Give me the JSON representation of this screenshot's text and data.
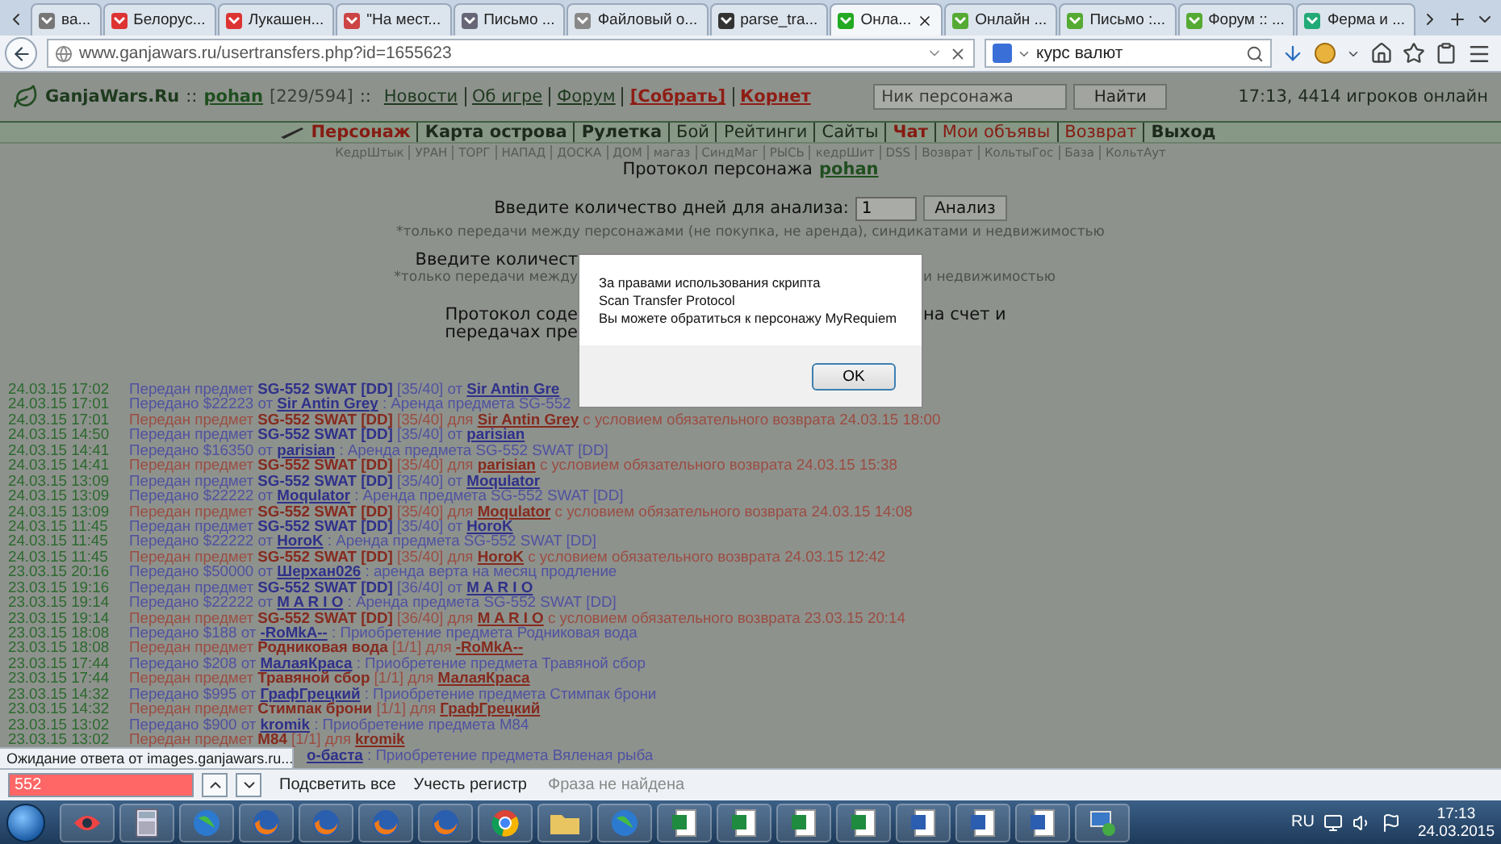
{
  "browser": {
    "tabs": [
      {
        "label": "ва...",
        "selected": false
      },
      {
        "label": "Белорус...",
        "selected": false
      },
      {
        "label": "Лукашен...",
        "selected": false
      },
      {
        "label": "\"На мест...",
        "selected": false
      },
      {
        "label": "Письмо ...",
        "selected": false
      },
      {
        "label": "Файловый о...",
        "selected": false
      },
      {
        "label": "parse_tra...",
        "selected": false
      },
      {
        "label": "Онла...",
        "selected": true
      },
      {
        "label": "Онлайн ...",
        "selected": false
      },
      {
        "label": "Письмо :...",
        "selected": false
      },
      {
        "label": "Форум :: ...",
        "selected": false
      },
      {
        "label": "Ферма и ...",
        "selected": false
      }
    ],
    "url": "www.ganjawars.ru/usertransfers.php?id=1655623",
    "search": "курс валют"
  },
  "header": {
    "brand": "GanjaWars.Ru",
    "separators": [
      "::",
      "::"
    ],
    "user": "pohan",
    "stats": "[229/594]",
    "links": [
      {
        "label": "Новости",
        "kind": "link"
      },
      {
        "label": "Об игре",
        "kind": "link"
      },
      {
        "label": "Форум",
        "kind": "link"
      },
      {
        "label": "[Собрать]",
        "kind": "action"
      },
      {
        "label": "Корнет",
        "kind": "action"
      }
    ],
    "search": {
      "placeholder": "Ник персонажа",
      "button": "Найти"
    },
    "online": "17:13, 4414 игроков онлайн"
  },
  "menu": [
    {
      "label": "Персонаж",
      "kind": "red-bold"
    },
    {
      "label": "Карта острова",
      "kind": "bold"
    },
    {
      "label": "Рулетка",
      "kind": "bold"
    },
    {
      "label": "Бой",
      "kind": "plain"
    },
    {
      "label": "Рейтинги",
      "kind": "plain"
    },
    {
      "label": "Сайты",
      "kind": "plain"
    },
    {
      "label": "Чат",
      "kind": "red-bold"
    },
    {
      "label": "Мои объявы",
      "kind": "red"
    },
    {
      "label": "Возврат",
      "kind": "red"
    },
    {
      "label": "Выход",
      "kind": "bold"
    }
  ],
  "sublinks": [
    "КедрШтык",
    "УРАН",
    "ТОРГ",
    "НАПАД",
    "ДОСКА",
    "ДОМ",
    "магаз",
    "СиндМаг",
    "РЫСЬ",
    "кедрШит",
    "DSS",
    "Возврат",
    "КольтыГос",
    "База",
    "КольтАут"
  ],
  "title": {
    "text": "Протокол персонажа",
    "user": "pohan"
  },
  "form": {
    "label": "Введите количество дней для анализа:",
    "value": "1",
    "button": "Анализ",
    "note": "*только передачи между персонажами (не покупка, не аренда), синдикатами и недвижимостью"
  },
  "covered_lines": [
    {
      "kind": "label",
      "left": "Введите количест"
    },
    {
      "kind": "note",
      "left": "*только передачи между",
      "right": "и недвижимостью"
    },
    {
      "kind": "text",
      "left": "Протокол соде",
      "right": "на счет и"
    },
    {
      "kind": "text",
      "left": "передачах пре"
    }
  ],
  "log": [
    {
      "date": "24.03.15 17:02",
      "outgoing": false,
      "parts": [
        {
          "kind": "text",
          "text": "Передан предмет"
        },
        {
          "kind": "bold",
          "text": "SG-552 SWAT [DD]"
        },
        {
          "kind": "text",
          "text": "[35/40] от"
        },
        {
          "kind": "link",
          "text": "Sir Antin Gre"
        }
      ]
    },
    {
      "date": "24.03.15 17:01",
      "outgoing": false,
      "parts": [
        {
          "kind": "text",
          "text": "Передано $22223 от"
        },
        {
          "kind": "link",
          "text": "Sir Antin Grey"
        },
        {
          "kind": "text",
          "text": ": Аренда предмета SG-552"
        }
      ]
    },
    {
      "date": "24.03.15 17:01",
      "outgoing": true,
      "parts": [
        {
          "kind": "text",
          "text": "Передан предмет"
        },
        {
          "kind": "bold",
          "text": "SG-552 SWAT [DD]"
        },
        {
          "kind": "text",
          "text": "[35/40] для"
        },
        {
          "kind": "link",
          "text": "Sir Antin Grey"
        },
        {
          "kind": "text",
          "text": "с условием обязательного возврата 24.03.15 18:00"
        }
      ]
    },
    {
      "date": "24.03.15 14:50",
      "outgoing": false,
      "parts": [
        {
          "kind": "text",
          "text": "Передан предмет"
        },
        {
          "kind": "bold",
          "text": "SG-552 SWAT [DD]"
        },
        {
          "kind": "text",
          "text": "[35/40] от"
        },
        {
          "kind": "link",
          "text": "parisian"
        }
      ]
    },
    {
      "date": "24.03.15 14:41",
      "outgoing": false,
      "parts": [
        {
          "kind": "text",
          "text": "Передано $16350 от"
        },
        {
          "kind": "link",
          "text": "parisian"
        },
        {
          "kind": "text",
          "text": ": Аренда предмета SG-552 SWAT [DD]"
        }
      ]
    },
    {
      "date": "24.03.15 14:41",
      "outgoing": true,
      "parts": [
        {
          "kind": "text",
          "text": "Передан предмет"
        },
        {
          "kind": "bold",
          "text": "SG-552 SWAT [DD]"
        },
        {
          "kind": "text",
          "text": "[35/40] для"
        },
        {
          "kind": "link",
          "text": "parisian"
        },
        {
          "kind": "text",
          "text": "с условием обязательного возврата 24.03.15 15:38"
        }
      ]
    },
    {
      "date": "24.03.15 13:09",
      "outgoing": false,
      "parts": [
        {
          "kind": "text",
          "text": "Передан предмет"
        },
        {
          "kind": "bold",
          "text": "SG-552 SWAT [DD]"
        },
        {
          "kind": "text",
          "text": "[35/40] от"
        },
        {
          "kind": "link",
          "text": "Moqulator"
        }
      ]
    },
    {
      "date": "24.03.15 13:09",
      "outgoing": false,
      "parts": [
        {
          "kind": "text",
          "text": "Передано $22222 от"
        },
        {
          "kind": "link",
          "text": "Moqulator"
        },
        {
          "kind": "text",
          "text": ": Аренда предмета SG-552 SWAT [DD]"
        }
      ]
    },
    {
      "date": "24.03.15 13:09",
      "outgoing": true,
      "parts": [
        {
          "kind": "text",
          "text": "Передан предмет"
        },
        {
          "kind": "bold",
          "text": "SG-552 SWAT [DD]"
        },
        {
          "kind": "text",
          "text": "[35/40] для"
        },
        {
          "kind": "link",
          "text": "Moqulator"
        },
        {
          "kind": "text",
          "text": "с условием обязательного возврата 24.03.15 14:08"
        }
      ]
    },
    {
      "date": "24.03.15 11:45",
      "outgoing": false,
      "parts": [
        {
          "kind": "text",
          "text": "Передан предмет"
        },
        {
          "kind": "bold",
          "text": "SG-552 SWAT [DD]"
        },
        {
          "kind": "text",
          "text": "[35/40] от"
        },
        {
          "kind": "link",
          "text": "HoroK"
        }
      ]
    },
    {
      "date": "24.03.15 11:45",
      "outgoing": false,
      "parts": [
        {
          "kind": "text",
          "text": "Передано $22222 от"
        },
        {
          "kind": "link",
          "text": "HoroK"
        },
        {
          "kind": "text",
          "text": ": Аренда предмета SG-552 SWAT [DD]"
        }
      ]
    },
    {
      "date": "24.03.15 11:45",
      "outgoing": true,
      "parts": [
        {
          "kind": "text",
          "text": "Передан предмет"
        },
        {
          "kind": "bold",
          "text": "SG-552 SWAT [DD]"
        },
        {
          "kind": "text",
          "text": "[35/40] для"
        },
        {
          "kind": "link",
          "text": "HoroK"
        },
        {
          "kind": "text",
          "text": "с условием обязательного возврата 24.03.15 12:42"
        }
      ]
    },
    {
      "date": "23.03.15 20:16",
      "outgoing": false,
      "parts": [
        {
          "kind": "text",
          "text": "Передано $50000 от"
        },
        {
          "kind": "link",
          "text": "Шерхан026"
        },
        {
          "kind": "text",
          "text": ": аренда верта на месяц продление"
        }
      ]
    },
    {
      "date": "23.03.15 19:16",
      "outgoing": false,
      "parts": [
        {
          "kind": "text",
          "text": "Передан предмет"
        },
        {
          "kind": "bold",
          "text": "SG-552 SWAT [DD]"
        },
        {
          "kind": "text",
          "text": "[36/40] от"
        },
        {
          "kind": "link",
          "text": "M A R I O"
        }
      ]
    },
    {
      "date": "23.03.15 19:14",
      "outgoing": false,
      "parts": [
        {
          "kind": "text",
          "text": "Передано $22222 от"
        },
        {
          "kind": "link",
          "text": "M A R I O"
        },
        {
          "kind": "text",
          "text": ": Аренда предмета SG-552 SWAT [DD]"
        }
      ]
    },
    {
      "date": "23.03.15 19:14",
      "outgoing": true,
      "parts": [
        {
          "kind": "text",
          "text": "Передан предмет"
        },
        {
          "kind": "bold",
          "text": "SG-552 SWAT [DD]"
        },
        {
          "kind": "text",
          "text": "[36/40] для"
        },
        {
          "kind": "link",
          "text": "M A R I O"
        },
        {
          "kind": "text",
          "text": "с условием обязательного возврата 23.03.15 20:14"
        }
      ]
    },
    {
      "date": "23.03.15 18:08",
      "outgoing": false,
      "parts": [
        {
          "kind": "text",
          "text": "Передано $188 от"
        },
        {
          "kind": "link",
          "text": "-RoMkA--"
        },
        {
          "kind": "text",
          "text": ": Приобретение предмета Родниковая вода"
        }
      ]
    },
    {
      "date": "23.03.15 18:08",
      "outgoing": true,
      "parts": [
        {
          "kind": "text",
          "text": "Передан предмет"
        },
        {
          "kind": "bold",
          "text": "Родниковая вода"
        },
        {
          "kind": "text",
          "text": "[1/1] для"
        },
        {
          "kind": "link",
          "text": "-RoMkA--"
        }
      ]
    },
    {
      "date": "23.03.15 17:44",
      "outgoing": false,
      "parts": [
        {
          "kind": "text",
          "text": "Передано $208 от"
        },
        {
          "kind": "link",
          "text": "МалаяКраса"
        },
        {
          "kind": "text",
          "text": ": Приобретение предмета Травяной сбор"
        }
      ]
    },
    {
      "date": "23.03.15 17:44",
      "outgoing": true,
      "parts": [
        {
          "kind": "text",
          "text": "Передан предмет"
        },
        {
          "kind": "bold",
          "text": "Травяной сбор"
        },
        {
          "kind": "text",
          "text": "[1/1] для"
        },
        {
          "kind": "link",
          "text": "МалаяКраса"
        }
      ]
    },
    {
      "date": "23.03.15 14:32",
      "outgoing": false,
      "parts": [
        {
          "kind": "text",
          "text": "Передано $995 от"
        },
        {
          "kind": "link",
          "text": "ГрафГрецкий"
        },
        {
          "kind": "text",
          "text": ": Приобретение предмета Стимпак брони"
        }
      ]
    },
    {
      "date": "23.03.15 14:32",
      "outgoing": true,
      "parts": [
        {
          "kind": "text",
          "text": "Передан предмет"
        },
        {
          "kind": "bold",
          "text": "Стимпак брони"
        },
        {
          "kind": "text",
          "text": "[1/1] для"
        },
        {
          "kind": "link",
          "text": "ГрафГрецкий"
        }
      ]
    },
    {
      "date": "23.03.15 13:02",
      "outgoing": false,
      "parts": [
        {
          "kind": "text",
          "text": "Передано $900 от"
        },
        {
          "kind": "link",
          "text": "kromik"
        },
        {
          "kind": "text",
          "text": ": Приобретение предмета M84"
        }
      ]
    },
    {
      "date": "23.03.15 13:02",
      "outgoing": true,
      "parts": [
        {
          "kind": "text",
          "text": "Передан предмет"
        },
        {
          "kind": "bold",
          "text": "M84"
        },
        {
          "kind": "text",
          "text": "[1/1] для"
        },
        {
          "kind": "link",
          "text": "kromik"
        }
      ]
    },
    {
      "outgoing": false,
      "parts": [
        {
          "kind": "link",
          "text": "о-баста"
        },
        {
          "kind": "text",
          "text": ": Приобретение предмета Вяленая рыба"
        }
      ]
    }
  ],
  "dialog": {
    "lines": [
      "За правами использования скрипта",
      "Scan Transfer Protocol",
      "Вы можете обратиться к персонажу MyRequiem"
    ],
    "button": "OK"
  },
  "status_popup": "Ожидание ответа от images.ganjawars.ru...",
  "find_bar": {
    "value": "552",
    "not_found": true,
    "highlight_all": "Подсветить все",
    "match_case": "Учесть регистр",
    "status": "Фраза не найдена"
  },
  "taskbar": {
    "language": "RU",
    "time": "17:13",
    "date": "24.03.2015"
  }
}
